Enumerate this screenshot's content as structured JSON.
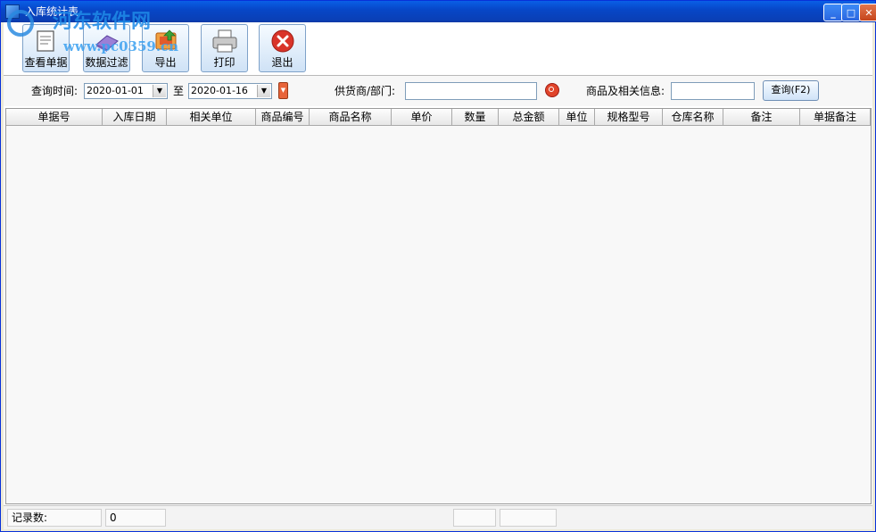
{
  "window": {
    "title": "入库统计表"
  },
  "watermark": {
    "line1": "河东软件网",
    "line2": "www.pc0359.cn"
  },
  "toolbar": {
    "view_document": "查看单据",
    "data_filter": "数据过滤",
    "export": "导出",
    "print": "打印",
    "exit": "退出"
  },
  "filter": {
    "query_time_label": "查询时间:",
    "date_from": "2020-01-01",
    "to_label": "至",
    "date_to": "2020-01-16",
    "supplier_label": "供货商/部门:",
    "supplier_value": "",
    "goods_label": "商品及相关信息:",
    "goods_value": "",
    "query_button": "查询(F2)"
  },
  "grid": {
    "columns": [
      "单据号",
      "入库日期",
      "相关单位",
      "商品编号",
      "商品名称",
      "单价",
      "数量",
      "总金额",
      "单位",
      "规格型号",
      "仓库名称",
      "备注",
      "单据备注"
    ],
    "rows": []
  },
  "status": {
    "record_label": "记录数:",
    "record_count": "0"
  },
  "colors": {
    "titlebar": "#0a4fd6",
    "exit_icon": "#d9342a",
    "export_icon": "#e07a2a"
  }
}
